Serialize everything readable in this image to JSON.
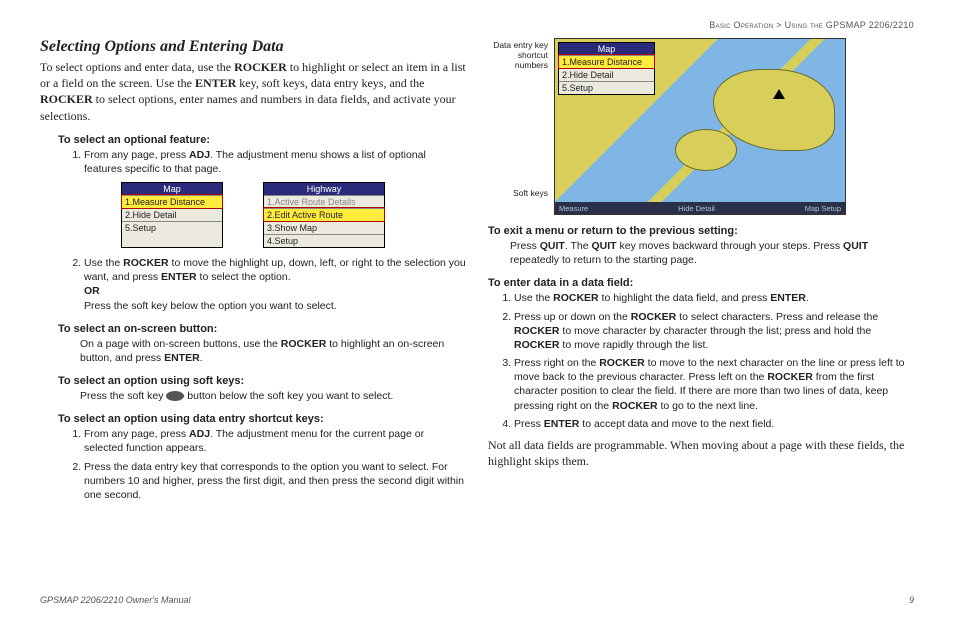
{
  "breadcrumb": {
    "section": "Basic Operation",
    "sep": " > ",
    "sub": "Using the GPSMAP 2206/2210"
  },
  "title": "Selecting Options and Entering Data",
  "intro": "To select options and enter data, use the ROCKER to highlight or select an item in a list or a field on the screen. Use the ENTER key, soft keys, data entry keys, and the ROCKER to select options, enter names and numbers in data fields, and activate your selections.",
  "left": {
    "h1": "To select an optional feature:",
    "s1_1a": "From any page, press ",
    "s1_1b": "ADJ",
    "s1_1c": ". The adjustment menu shows a list of optional features specific to that page.",
    "menu_map_title": "Map",
    "menu_map_rows": {
      "r1": "1.Measure Distance",
      "r2": "2.Hide Detail",
      "r3": "5.Setup"
    },
    "menu_hwy_title": "Highway",
    "menu_hwy_rows": {
      "r1": "1.Active Route Details",
      "r2": "2.Edit Active Route",
      "r3": "3.Show Map",
      "r4": "4.Setup"
    },
    "s1_2a": "Use the ",
    "s1_2b": "ROCKER",
    "s1_2c": " to move the highlight up, down, left, or right to the selection you want, and press ",
    "s1_2d": "ENTER",
    "s1_2e": " to select the option.",
    "s1_or": "OR",
    "s1_or2": "Press the soft key below the option you want to select.",
    "h2": "To select an on-screen button:",
    "s2": "On a page with on-screen buttons, use the ROCKER to highlight an on-screen button, and press ENTER.",
    "h3": "To select an option using soft keys:",
    "s3a": "Press the soft key ",
    "s3b": " button below the soft key you want to select.",
    "h4": "To select an option using data entry shortcut keys:",
    "s4_1": "From any page, press ADJ. The adjustment menu for the current page or selected function appears.",
    "s4_2": "Press the data entry key that corresponds to the option you want to select. For numbers 10 and higher, press the first digit, and then press the second digit within one second."
  },
  "right": {
    "callout1": "Data entry key shortcut numbers",
    "callout2": "Soft keys",
    "soft1": "Measure",
    "soft2": "Hide Detail",
    "soft3": "Map Setup",
    "h5": "To exit a menu or return to the previous setting:",
    "s5": "Press QUIT. The QUIT key moves backward through your steps. Press QUIT repeatedly to return to the starting page.",
    "h6": "To enter data in a data field:",
    "s6_1": "Use the ROCKER to highlight the data field, and press ENTER.",
    "s6_2": "Press up or down on the ROCKER to select characters. Press and release the ROCKER to move character by character through the list; press and hold the ROCKER to move rapidly through the list.",
    "s6_3": "Press right on the ROCKER to move to the next character on the line or press left to move back to the previous character. Press left on the ROCKER from the first character position to clear the field. If there are more than two lines of data, keep pressing right on the ROCKER to go to the next line.",
    "s6_4": "Press ENTER to accept data and move to the next field.",
    "note": "Not all data fields are programmable. When moving about a page with these fields, the highlight skips them."
  },
  "footer": {
    "left": "GPSMAP 2206/2210 Owner's Manual",
    "right": "9"
  }
}
